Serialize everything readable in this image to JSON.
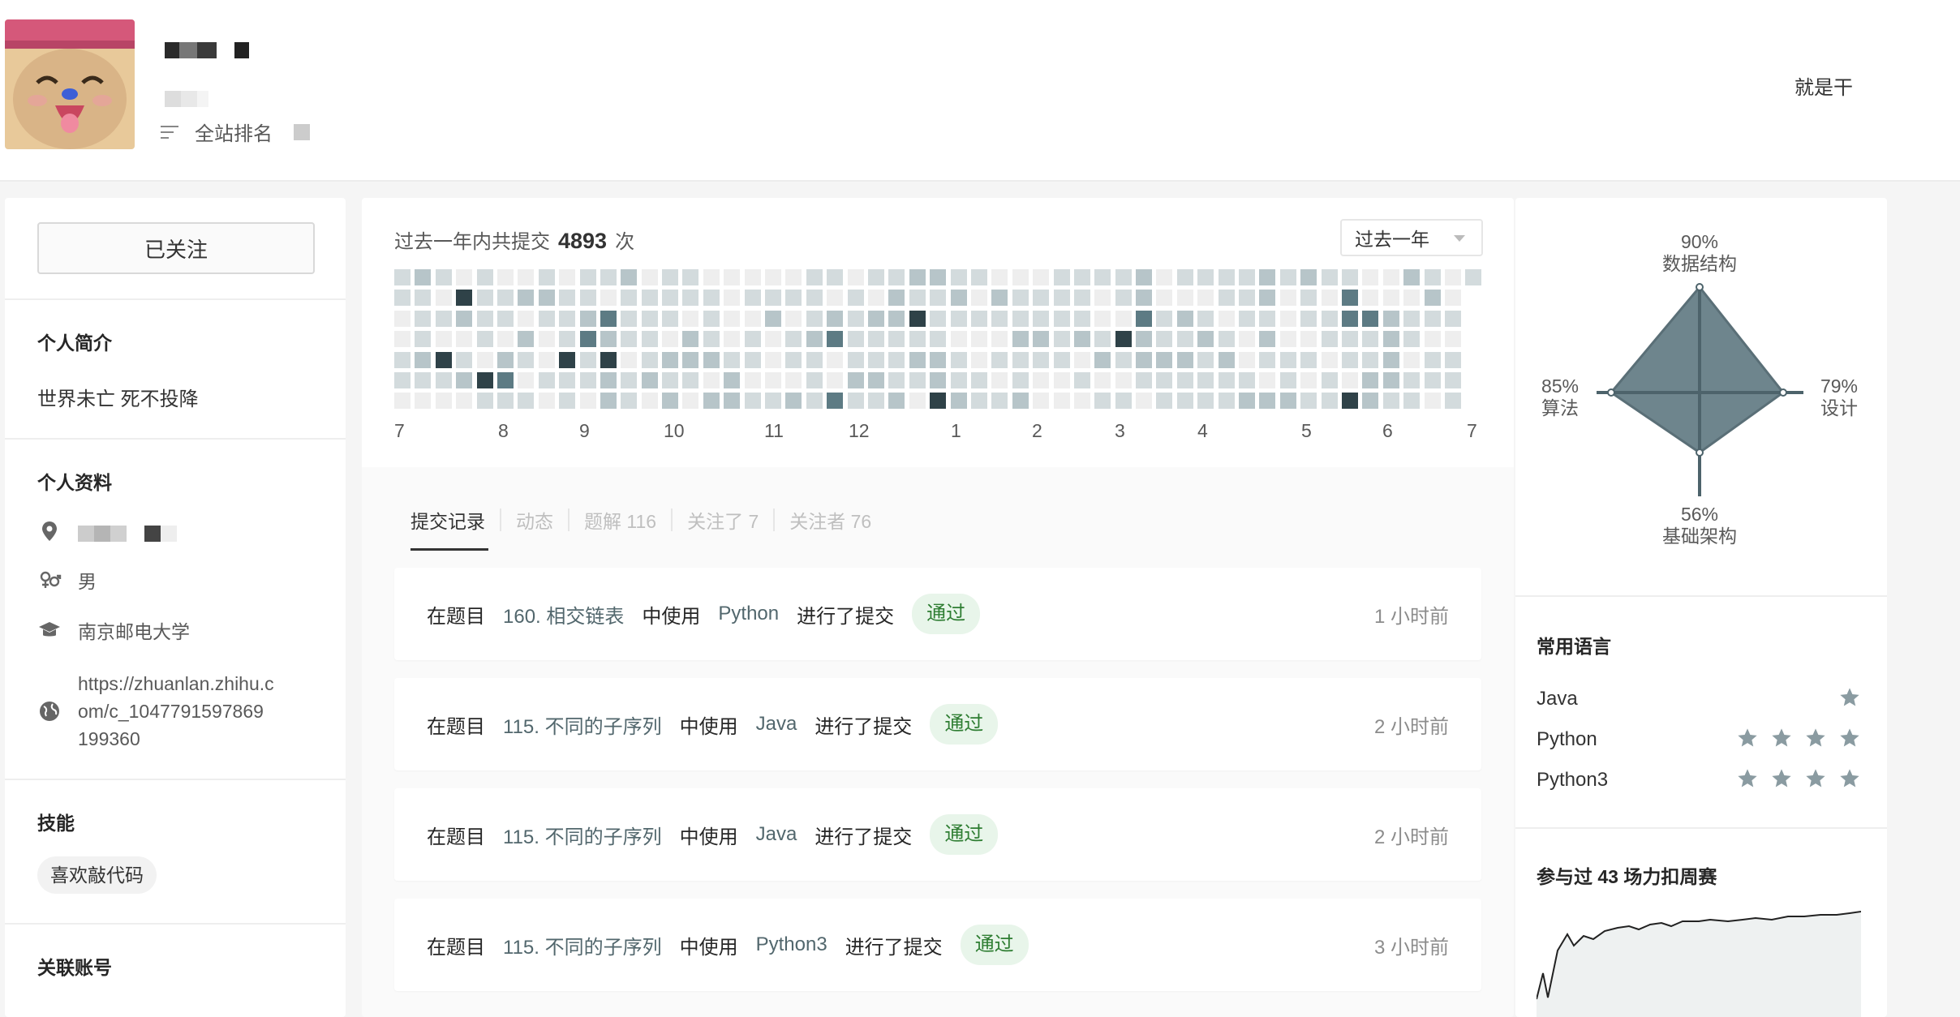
{
  "header": {
    "rank_label": "全站排名",
    "motto": "就是干"
  },
  "left": {
    "follow_button": "已关注",
    "bio_title": "个人简介",
    "bio_text": "世界未亡 死不投降",
    "profile_title": "个人资料",
    "gender": "男",
    "school": "南京邮电大学",
    "website": "https://zhuanlan.zhihu.com/c_1047791597869199360",
    "website_lines": [
      "https://zhuanlan.zhihu.c",
      "om/c_1047791597869",
      "199360"
    ],
    "skills_title": "技能",
    "skill_tag": "喜欢敲代码",
    "linked_title": "关联账号"
  },
  "heatmap": {
    "summary_prefix": "过去一年内共提交",
    "summary_count": "4893",
    "summary_suffix": "次",
    "range_selected": "过去一年",
    "months": [
      "7",
      "8",
      "9",
      "10",
      "11",
      "12",
      "1",
      "2",
      "3",
      "4",
      "5",
      "6",
      "7"
    ]
  },
  "tabs": [
    {
      "label": "提交记录",
      "active": true
    },
    {
      "label": "动态",
      "active": false
    },
    {
      "label": "题解 116",
      "active": false
    },
    {
      "label": "关注了 7",
      "active": false
    },
    {
      "label": "关注者 76",
      "active": false
    }
  ],
  "submissions": [
    {
      "lead": "在题目",
      "problem": "160. 相交链表",
      "mid": "中使用",
      "lang": "Python",
      "tail": "进行了提交",
      "status": "通过",
      "time": "1 小时前"
    },
    {
      "lead": "在题目",
      "problem": "115. 不同的子序列",
      "mid": "中使用",
      "lang": "Java",
      "tail": "进行了提交",
      "status": "通过",
      "time": "2 小时前"
    },
    {
      "lead": "在题目",
      "problem": "115. 不同的子序列",
      "mid": "中使用",
      "lang": "Java",
      "tail": "进行了提交",
      "status": "通过",
      "time": "2 小时前"
    },
    {
      "lead": "在题目",
      "problem": "115. 不同的子序列",
      "mid": "中使用",
      "lang": "Python3",
      "tail": "进行了提交",
      "status": "通过",
      "time": "3 小时前"
    }
  ],
  "radar": {
    "top": {
      "pct": "90%",
      "label": "数据结构"
    },
    "left": {
      "pct": "85%",
      "label": "算法"
    },
    "right": {
      "pct": "79%",
      "label": "设计"
    },
    "bottom": {
      "pct": "56%",
      "label": "基础架构"
    }
  },
  "languages": {
    "title": "常用语言",
    "items": [
      {
        "name": "Java",
        "stars": 1
      },
      {
        "name": "Python",
        "stars": 4
      },
      {
        "name": "Python3",
        "stars": 4
      }
    ]
  },
  "contest": {
    "title": "参与过 43 场力扣周赛"
  },
  "colors": {
    "accent": "#52676d",
    "pass_bg": "#e8f5ea",
    "pass_text": "#2e7d32",
    "heat_levels": [
      "#eeeeee",
      "#d3dbdd",
      "#b7c5c9",
      "#5d7b84",
      "#2f4248"
    ]
  }
}
